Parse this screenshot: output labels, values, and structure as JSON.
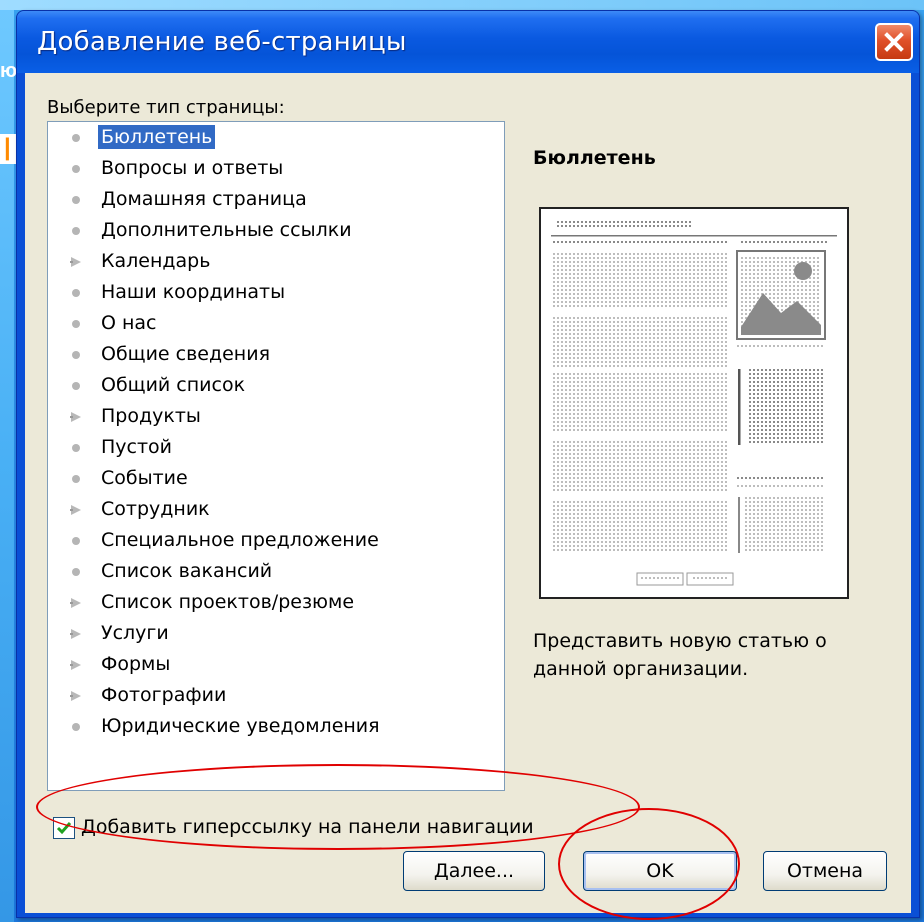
{
  "window": {
    "title": "Добавление веб-страницы"
  },
  "background": {
    "fragment_top": "ю",
    "fragment_left": "|"
  },
  "dialog": {
    "list_caption": "Выберите тип страницы:",
    "page_types": [
      {
        "label": "Бюллетень",
        "icon": "dot-bullet",
        "selected": true
      },
      {
        "label": "Вопросы и ответы",
        "icon": "dot-bullet"
      },
      {
        "label": "Домашняя страница",
        "icon": "dot-bullet"
      },
      {
        "label": "Дополнительные ссылки",
        "icon": "dot-bullet"
      },
      {
        "label": "Календарь",
        "icon": "triangle-bullet"
      },
      {
        "label": "Наши координаты",
        "icon": "dot-bullet"
      },
      {
        "label": "О нас",
        "icon": "dot-bullet"
      },
      {
        "label": "Общие сведения",
        "icon": "dot-bullet"
      },
      {
        "label": "Общий список",
        "icon": "dot-bullet"
      },
      {
        "label": "Продукты",
        "icon": "triangle-bullet"
      },
      {
        "label": "Пустой",
        "icon": "dot-bullet"
      },
      {
        "label": "Событие",
        "icon": "dot-bullet"
      },
      {
        "label": "Сотрудник",
        "icon": "triangle-bullet"
      },
      {
        "label": "Специальное предложение",
        "icon": "dot-bullet"
      },
      {
        "label": "Список вакансий",
        "icon": "dot-bullet"
      },
      {
        "label": "Список проектов/резюме",
        "icon": "triangle-bullet"
      },
      {
        "label": "Услуги",
        "icon": "triangle-bullet"
      },
      {
        "label": "Формы",
        "icon": "triangle-bullet"
      },
      {
        "label": "Фотографии",
        "icon": "triangle-bullet"
      },
      {
        "label": "Юридические уведомления",
        "icon": "dot-bullet"
      }
    ],
    "preview": {
      "title": "Бюллетень",
      "description": "Представить новую статью о данной организации."
    },
    "checkbox": {
      "label": "Добавить гиперссылку на панели навигации",
      "checked": true
    },
    "buttons": {
      "next": "Далее...",
      "ok": "OK",
      "cancel": "Отмена"
    }
  },
  "colors": {
    "title_bar": "#0a59e0",
    "selection": "#316ac5",
    "annotation": "#e00000",
    "dialog_face": "#ece9d8"
  }
}
